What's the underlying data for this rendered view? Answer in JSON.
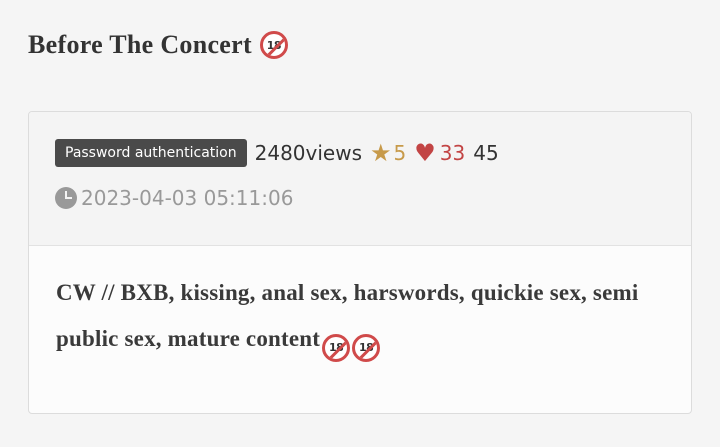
{
  "page": {
    "title": "Before The Concert"
  },
  "post": {
    "auth_badge": "Password authentication",
    "views": "2480views",
    "stars": "5",
    "hearts": "33",
    "comments": "45",
    "timestamp": "2023-04-03 05:11:06",
    "content": "CW // BXB, kissing, anal sex, harswords, quickie sex, semi public sex, mature content"
  },
  "icons": {
    "rating": "no-under-18-icon",
    "star": "star-icon",
    "heart": "heart-icon",
    "clock": "clock-icon"
  },
  "colors": {
    "star": "#c79a4a",
    "heart": "#c24444",
    "badge_bg": "#4a4a4a"
  }
}
